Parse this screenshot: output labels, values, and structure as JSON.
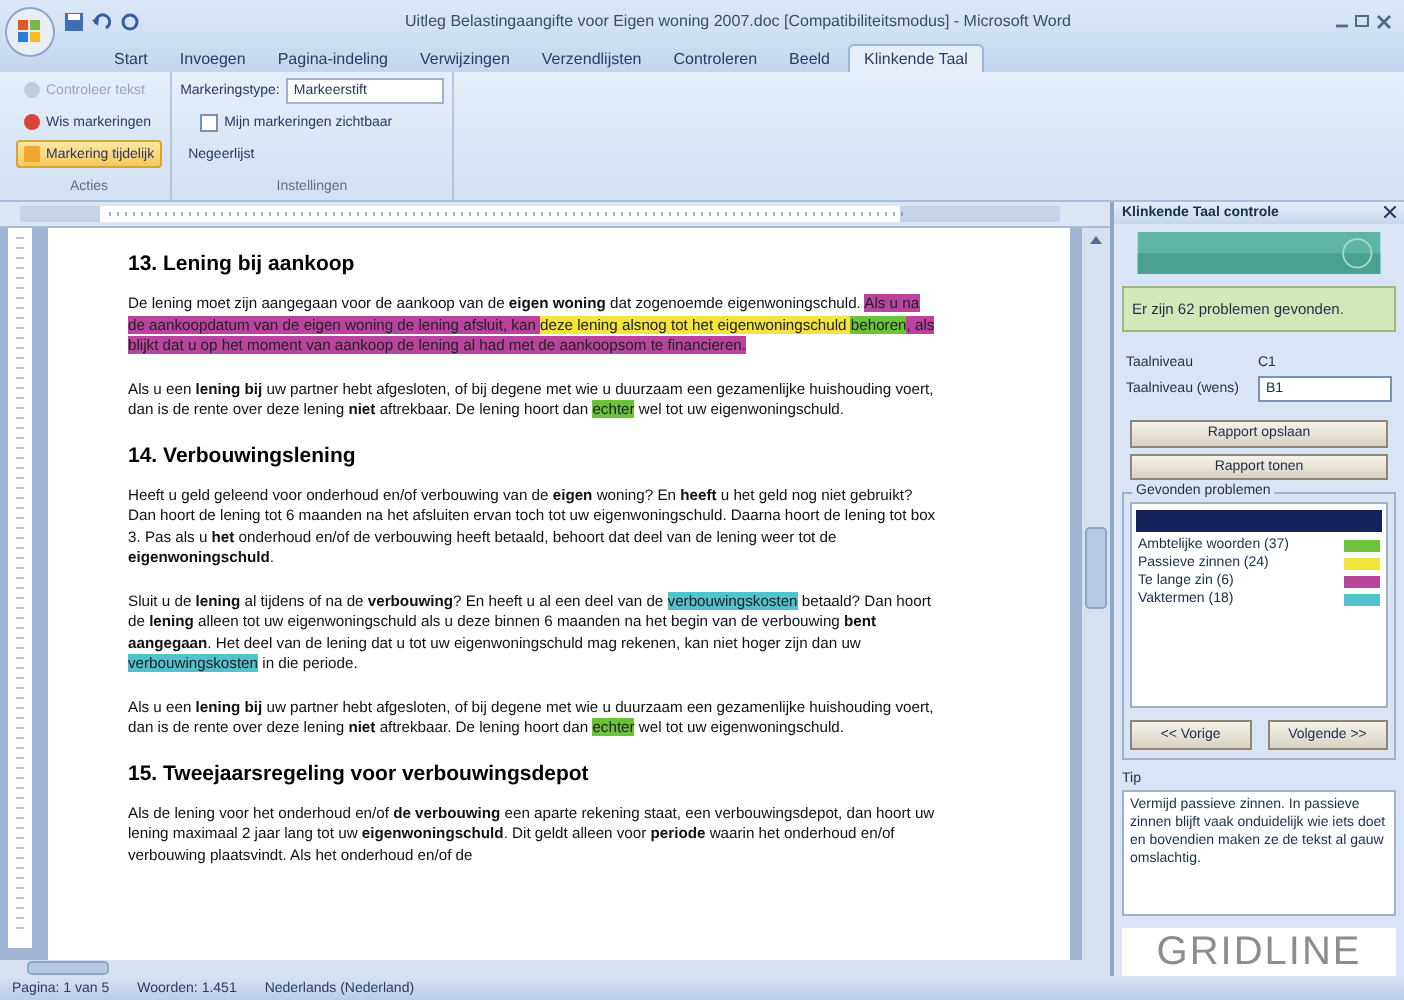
{
  "window": {
    "title": "Uitleg Belastingaangifte voor Eigen woning 2007.doc [Compatibiliteitsmodus] - Microsoft Word"
  },
  "ribbon_tabs": [
    {
      "label": "Start",
      "selected": false
    },
    {
      "label": "Invoegen",
      "selected": false
    },
    {
      "label": "Pagina-indeling",
      "selected": false
    },
    {
      "label": "Verwijzingen",
      "selected": false
    },
    {
      "label": "Verzendlijsten",
      "selected": false
    },
    {
      "label": "Controleren",
      "selected": false
    },
    {
      "label": "Beeld",
      "selected": false
    },
    {
      "label": "Klinkende Taal",
      "selected": true
    }
  ],
  "ribbon": {
    "groups": [
      {
        "label": "Acties",
        "controls": [
          {
            "kind": "button",
            "label": "Controleer tekst",
            "disabled": true
          },
          {
            "kind": "button",
            "label": "Wis markeringen",
            "disabled": false
          },
          {
            "kind": "toggle",
            "label": "Markering tijdelijk",
            "on": true
          }
        ]
      },
      {
        "label": "Instellingen",
        "controls": [
          {
            "kind": "dropdown",
            "label": "Markeringstype:",
            "value": "Markeerstift"
          },
          {
            "kind": "checkbox",
            "label": "Mijn markeringen zichtbaar",
            "checked": false
          },
          {
            "kind": "link",
            "label": "Negeerlijst"
          }
        ]
      }
    ]
  },
  "document": {
    "blocks": [
      {
        "kind": "heading",
        "text": "13. Lening bij aankoop"
      },
      {
        "kind": "paragraph",
        "segments": [
          {
            "text": "De lening moet zijn aangegaan voor de aankoop van de **eigen woning** dat zogenoemde eigenwoningschuld. "
          },
          {
            "text": "Als u na de aankoopdatum van de eigen woning de lening afsluit, kan ",
            "color": "#b8449e"
          },
          {
            "text": "deze lening alsnog tot het eigenwoningschuld ",
            "color": "#f2e43c"
          },
          {
            "text": "behoren",
            "color": "#6cc23a"
          },
          {
            "text": ", als blijkt dat u op het moment van aankoop de lening al had met de aankoopsom te financieren.",
            "color": "#b8449e"
          }
        ]
      },
      {
        "kind": "paragraph",
        "segments": [
          {
            "text": "Als u een **lening bij** uw partner hebt afgesloten, of bij degene met wie u duurzaam een gezamenlijke huishouding voert, dan is de rente over deze lening **niet** aftrekbaar. De lening hoort dan "
          },
          {
            "text": "echter",
            "color": "#6cc23a"
          },
          {
            "text": " wel tot uw eigenwoningschuld."
          }
        ]
      },
      {
        "kind": "heading",
        "text": "14. Verbouwingslening"
      },
      {
        "kind": "paragraph",
        "segments": [
          {
            "text": "Heeft u geld geleend voor onderhoud en/of verbouwing van de **eigen** woning? En **heeft** u het geld nog niet gebruikt? Dan hoort de lening tot 6 maanden na het afsluiten ervan toch tot uw eigenwoningschuld. Daarna hoort de lening tot box 3. Pas als u **het** onderhoud en/of de verbouwing heeft betaald, behoort dat deel van de lening weer tot de **eigenwoningschuld**."
          }
        ]
      },
      {
        "kind": "paragraph",
        "segments": [
          {
            "text": "Sluit u de **lening** al tijdens of na de **verbouwing**? En heeft u al een deel van de "
          },
          {
            "text": "verbouwingskosten",
            "color": "#52c2cf"
          },
          {
            "text": " betaald? Dan hoort de **lening** alleen tot uw eigenwoningschuld als u deze binnen 6 maanden na het begin van de verbouwing **bent aangegaan**. Het deel van de lening dat u tot uw eigenwoningschuld mag rekenen, kan niet hoger zijn dan uw "
          },
          {
            "text": "verbouwingskosten",
            "color": "#52c2cf"
          },
          {
            "text": " in die periode."
          }
        ]
      },
      {
        "kind": "paragraph",
        "segments": [
          {
            "text": "Als u een **lening bij** uw partner hebt afgesloten, of bij degene met wie u duurzaam een gezamenlijke huishouding voert, dan is de rente over deze lening **niet** aftrekbaar. De lening hoort dan "
          },
          {
            "text": "echter",
            "color": "#6cc23a"
          },
          {
            "text": " wel tot uw eigenwoningschuld."
          }
        ]
      },
      {
        "kind": "heading",
        "text": "15. Tweejaarsregeling voor verbouwingsdepot"
      },
      {
        "kind": "paragraph",
        "segments": [
          {
            "text": "Als de lening voor het onderhoud en/of **de verbouwing** een aparte rekening staat, een verbouwingsdepot, dan hoort uw lening maximaal 2 jaar lang tot uw **eigenwoningschuld**. Dit geldt alleen voor **periode** waarin het onderhoud en/of verbouwing plaatsvindt. Als het onderhoud en/of de"
          }
        ]
      }
    ]
  },
  "taskpane": {
    "title": "Klinkende Taal controle",
    "summary": "Er zijn 62 problemen gevonden.",
    "fields": [
      {
        "kind": "text",
        "label": "Taalniveau",
        "value": "C1"
      },
      {
        "kind": "dropdown",
        "label": "Taalniveau (wens)",
        "value": "B1"
      }
    ],
    "buttons": [
      "Rapport opslaan",
      "Rapport tonen"
    ],
    "issues_title": "Gevonden problemen",
    "issues": [
      {
        "label": "Ambtelijke woorden (37)",
        "color": "#6cc23a"
      },
      {
        "label": "Passieve zinnen (24)",
        "color": "#f2e43c"
      },
      {
        "label": "Te lange zin (6)",
        "color": "#b8449e"
      },
      {
        "label": "Vaktermen (18)",
        "color": "#52c2cf"
      }
    ],
    "nav": [
      "<< Vorige",
      "Volgende >>"
    ],
    "tip_label": "Tip",
    "tip": "Vermijd passieve zinnen. In passieve zinnen blijft vaak onduidelijk wie iets doet en bovendien maken ze de tekst al gauw omslachtig.",
    "logo": "GRIDLINE"
  },
  "status_bar": [
    "Pagina: 1 van 5",
    "Woorden: 1.451",
    "Nederlands (Nederland)"
  ]
}
